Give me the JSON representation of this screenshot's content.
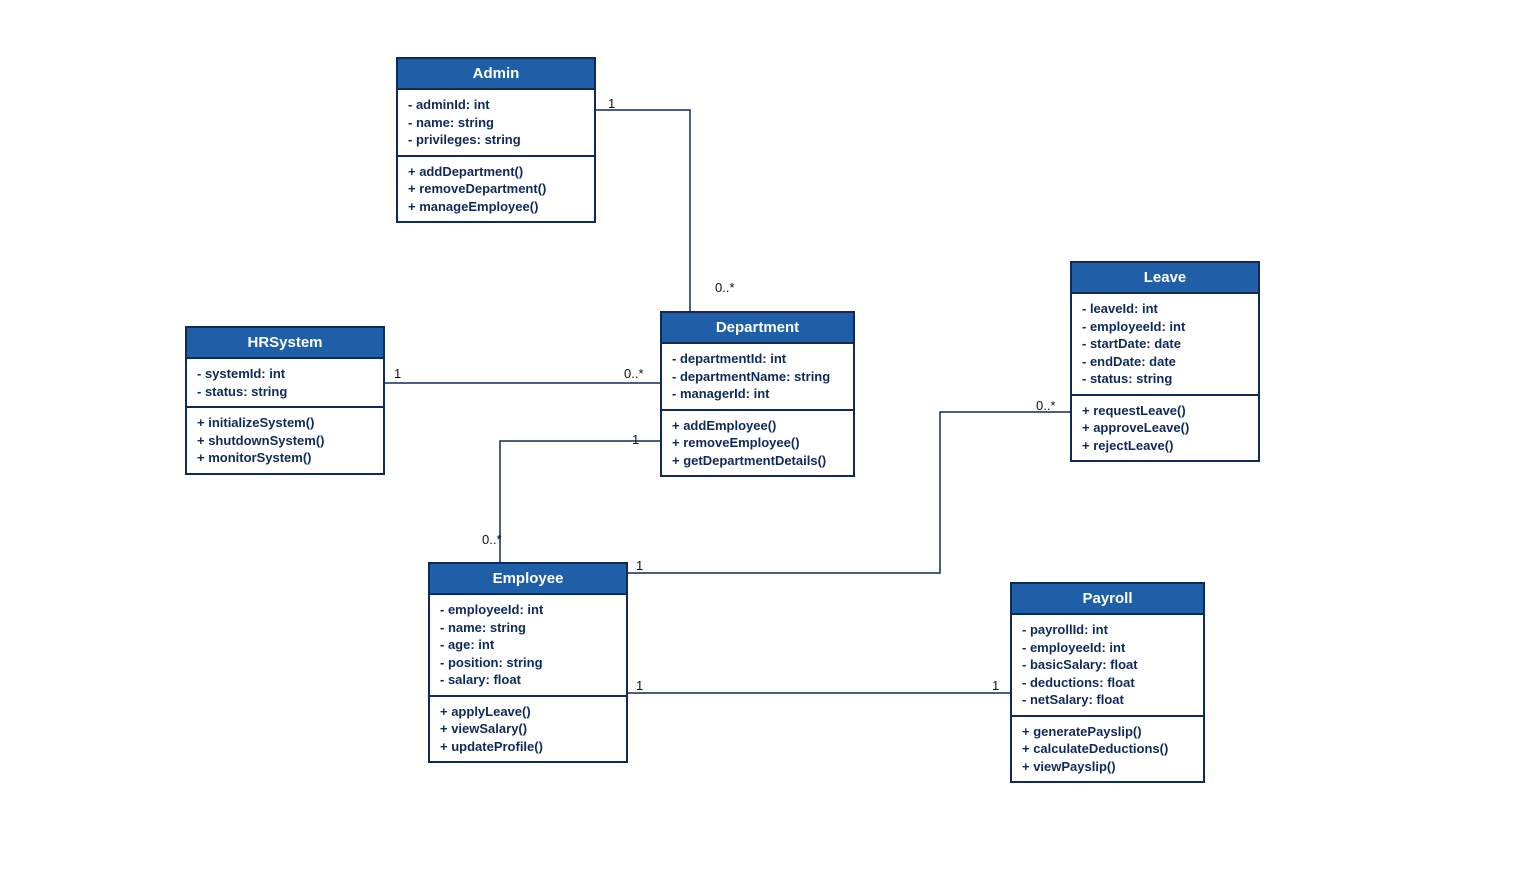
{
  "diagram_type": "UML Class Diagram",
  "classes": {
    "admin": {
      "name": "Admin",
      "attributes": [
        "- adminId: int",
        "- name: string",
        "- privileges: string"
      ],
      "methods": [
        "+ addDepartment()",
        "+ removeDepartment()",
        "+ manageEmployee()"
      ]
    },
    "hrsystem": {
      "name": "HRSystem",
      "attributes": [
        "- systemId: int",
        "- status: string"
      ],
      "methods": [
        "+ initializeSystem()",
        "+ shutdownSystem()",
        "+ monitorSystem()"
      ]
    },
    "department": {
      "name": "Department",
      "attributes": [
        "- departmentId: int",
        "- departmentName: string",
        "- managerId: int"
      ],
      "methods": [
        "+ addEmployee()",
        "+ removeEmployee()",
        "+ getDepartmentDetails()"
      ]
    },
    "employee": {
      "name": "Employee",
      "attributes": [
        "- employeeId: int",
        "- name: string",
        "- age: int",
        "- position: string",
        "- salary: float"
      ],
      "methods": [
        "+ applyLeave()",
        "+ viewSalary()",
        "+ updateProfile()"
      ]
    },
    "leave": {
      "name": "Leave",
      "attributes": [
        "- leaveId: int",
        "- employeeId: int",
        "- startDate: date",
        "- endDate: date",
        "- status: string"
      ],
      "methods": [
        "+ requestLeave()",
        "+ approveLeave()",
        "+ rejectLeave()"
      ]
    },
    "payroll": {
      "name": "Payroll",
      "attributes": [
        "- payrollId: int",
        "- employeeId: int",
        "- basicSalary: float",
        "- deductions: float",
        "- netSalary: float"
      ],
      "methods": [
        "+ generatePayslip()",
        "+ calculateDeductions()",
        "+ viewPayslip()"
      ]
    }
  },
  "associations": [
    {
      "from": "Admin",
      "to": "Department",
      "from_mult": "1",
      "to_mult": "0..*"
    },
    {
      "from": "HRSystem",
      "to": "Department",
      "from_mult": "1",
      "to_mult": "0..*"
    },
    {
      "from": "Department",
      "to": "Employee",
      "from_mult": "1",
      "to_mult": "0..*"
    },
    {
      "from": "Employee",
      "to": "Leave",
      "from_mult": "1",
      "to_mult": "0..*"
    },
    {
      "from": "Employee",
      "to": "Payroll",
      "from_mult": "1",
      "to_mult": "1"
    }
  ],
  "mlabels": {
    "admin_dept_1": "1",
    "admin_dept_n": "0..*",
    "hr_dept_1": "1",
    "hr_dept_n": "0..*",
    "dept_emp_1": "1",
    "dept_emp_n": "0..*",
    "emp_leave_1": "1",
    "emp_leave_n": "0..*",
    "emp_payroll_1a": "1",
    "emp_payroll_1b": "1"
  }
}
